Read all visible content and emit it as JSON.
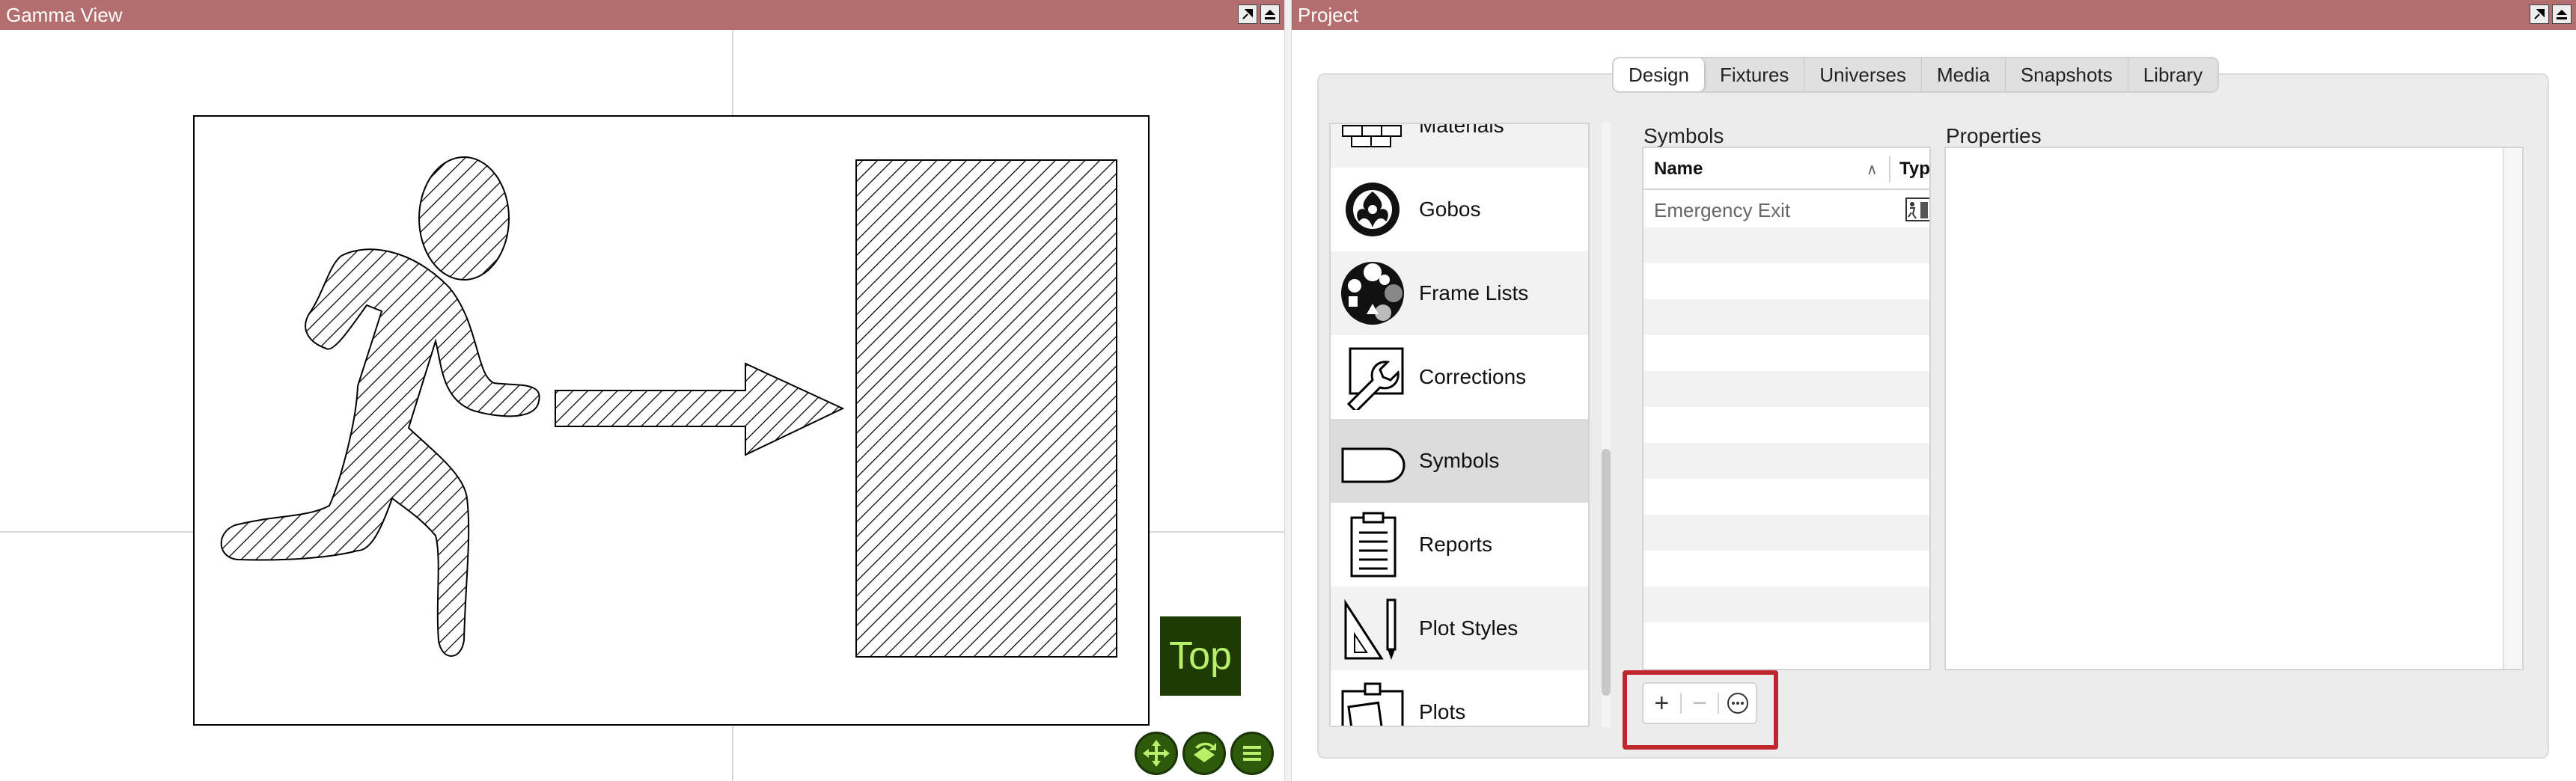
{
  "gamma_view": {
    "title": "Gamma View",
    "view_badge": "Top",
    "symbol_name": "Emergency Exit"
  },
  "project": {
    "title": "Project",
    "tabs": [
      {
        "label": "Design",
        "active": true
      },
      {
        "label": "Fixtures",
        "active": false
      },
      {
        "label": "Universes",
        "active": false
      },
      {
        "label": "Media",
        "active": false
      },
      {
        "label": "Snapshots",
        "active": false
      },
      {
        "label": "Library",
        "active": false
      }
    ],
    "categories": [
      {
        "label": "Materials",
        "icon": "materials-icon"
      },
      {
        "label": "Gobos",
        "icon": "gobo-icon"
      },
      {
        "label": "Frame Lists",
        "icon": "frame-list-icon"
      },
      {
        "label": "Corrections",
        "icon": "wrench-icon"
      },
      {
        "label": "Symbols",
        "icon": "symbol-icon",
        "selected": true
      },
      {
        "label": "Reports",
        "icon": "clipboard-icon"
      },
      {
        "label": "Plot Styles",
        "icon": "drafting-tools-icon"
      },
      {
        "label": "Plots",
        "icon": "plots-icon"
      }
    ],
    "symbols_label": "Symbols",
    "properties_label": "Properties",
    "table": {
      "col_name": "Name",
      "col_type": "Typ",
      "rows": [
        {
          "name": "Emergency Exit",
          "icon": "exit-sign-icon"
        }
      ]
    },
    "actions": {
      "add": "+",
      "remove": "−",
      "more": "⋯"
    }
  },
  "colors": {
    "titlebar": "#b36f6f",
    "badge_bg": "#1f3a05",
    "badge_fg": "#b9f06a",
    "highlight": "#c0262e"
  }
}
